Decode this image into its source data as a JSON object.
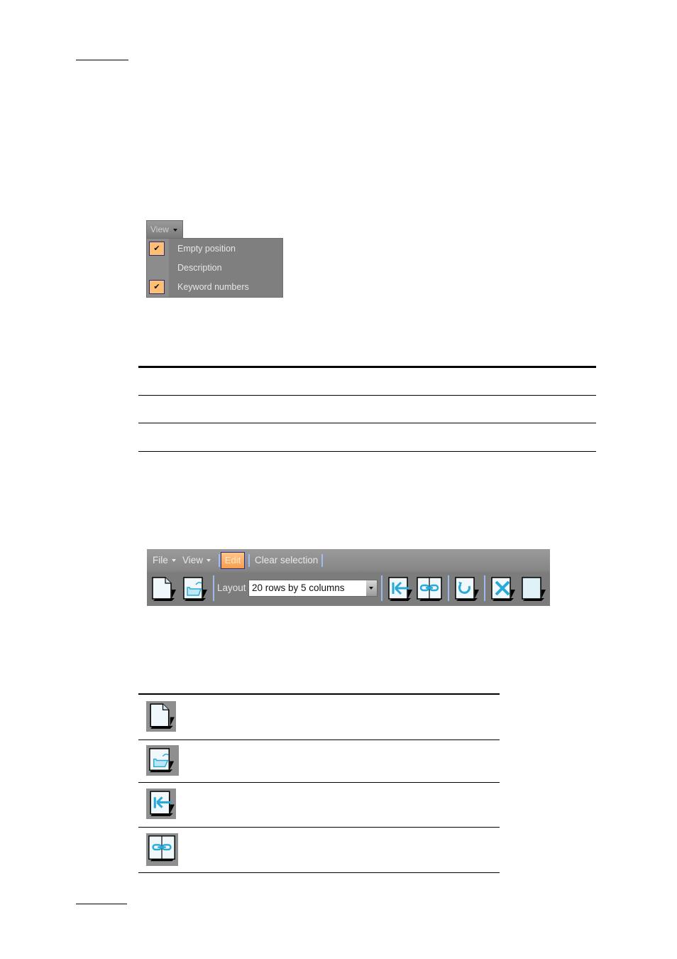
{
  "view_menu": {
    "button_label": "View",
    "items": [
      {
        "label": "Empty position",
        "checked": true
      },
      {
        "label": "Description",
        "checked": false
      },
      {
        "label": "Keyword numbers",
        "checked": true
      }
    ],
    "check_glyph": "✔"
  },
  "toolbar": {
    "menu": {
      "file_label": "File",
      "view_label": "View",
      "edit_label": "Edit",
      "clear_selection_label": "Clear selection"
    },
    "layout_label": "Layout",
    "layout_value": "20 rows by 5 columns",
    "icons": [
      "new-document-icon",
      "open-folder-icon",
      "import-icon",
      "link-icon",
      "refresh-icon",
      "delete-icon",
      "blank-page-icon"
    ]
  },
  "icon_table": {
    "rows": [
      {
        "icon": "new-document-icon",
        "description": ""
      },
      {
        "icon": "open-folder-icon",
        "description": ""
      },
      {
        "icon": "import-icon",
        "description": ""
      },
      {
        "icon": "link-icon",
        "description": ""
      }
    ]
  },
  "colors": {
    "menu_bg": "#7f7f7f",
    "checked_bg": "#ffbf73",
    "edit_active": "#f79e4c",
    "icon_accent": "#29a9d8",
    "separator": "#a7c3ff"
  }
}
